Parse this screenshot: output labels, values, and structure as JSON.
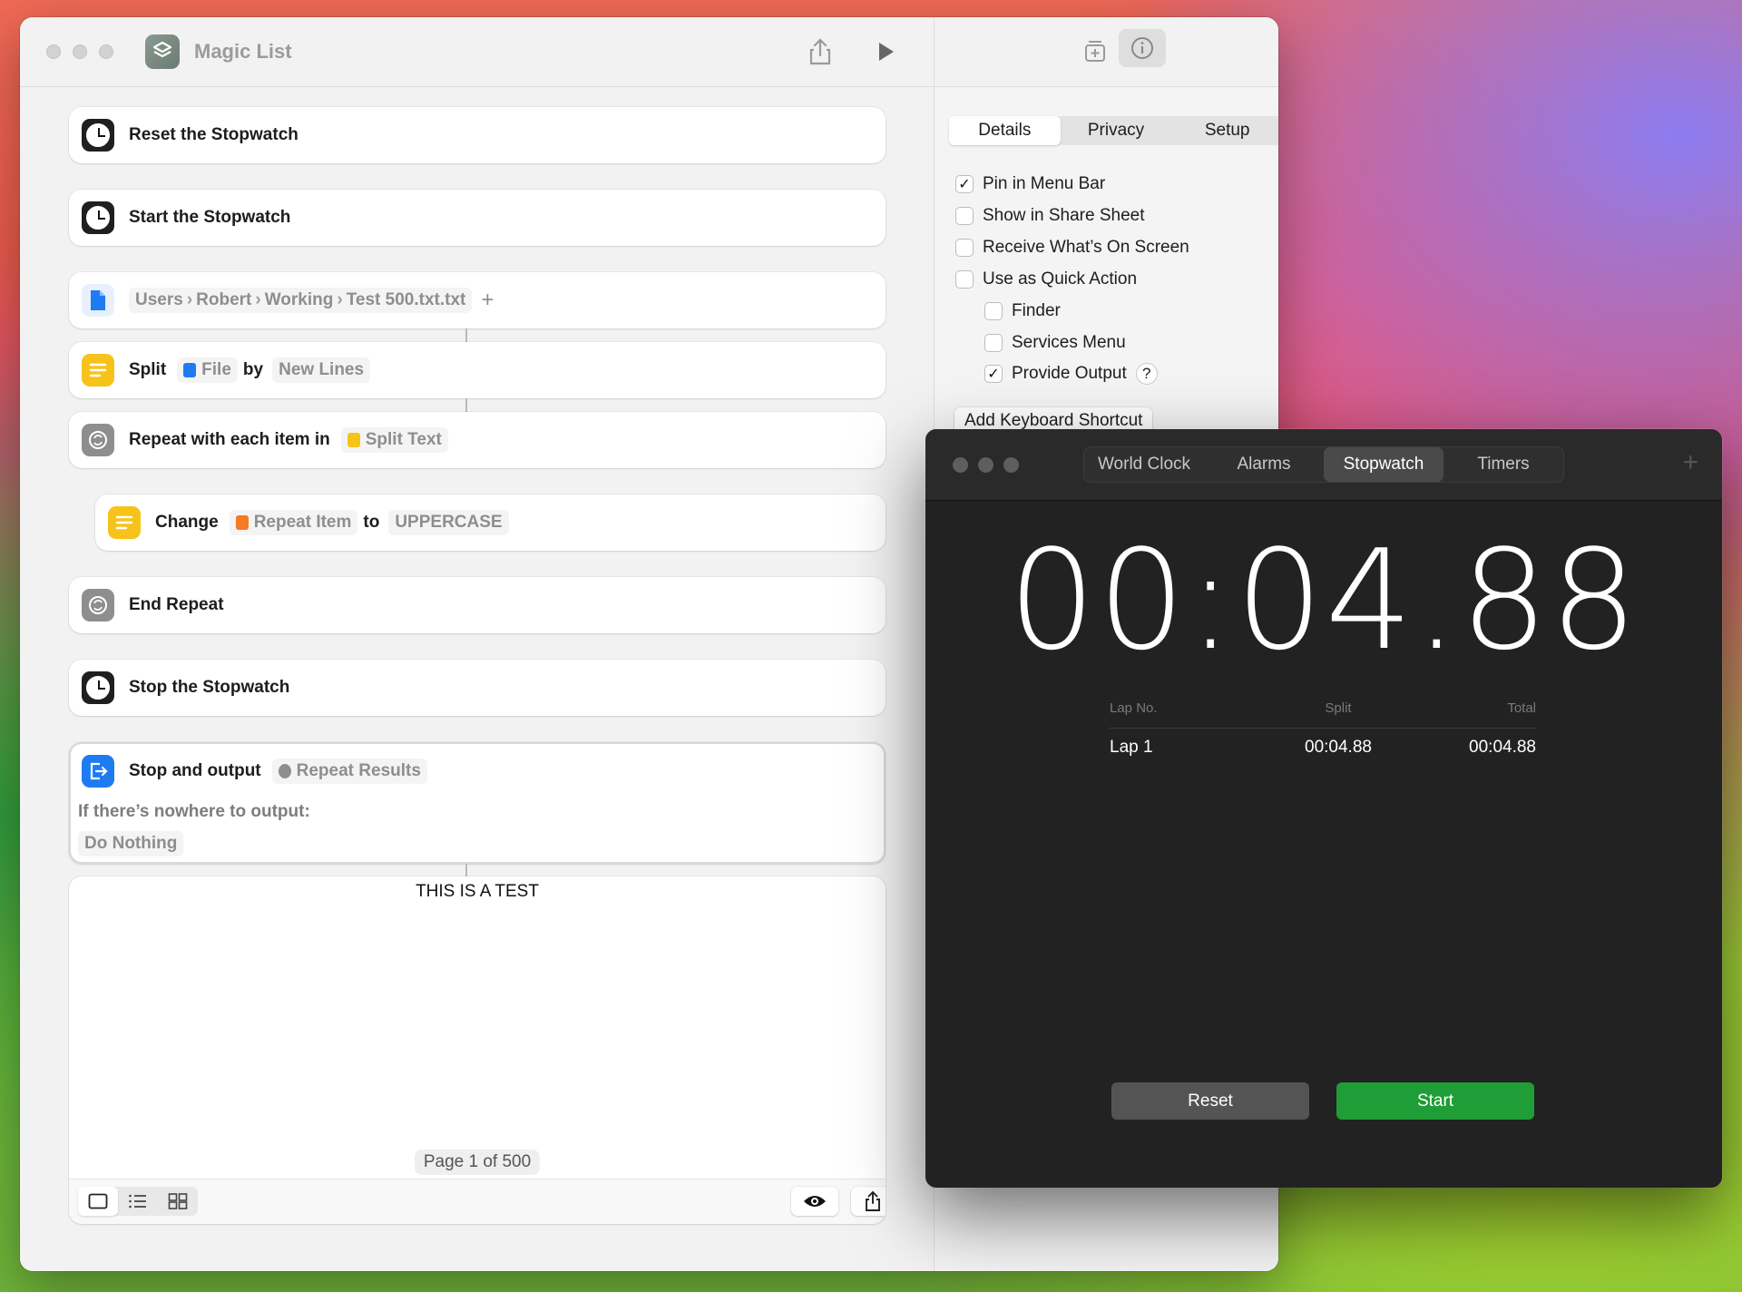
{
  "shortcuts": {
    "title": "Magic List",
    "actions": {
      "reset": "Reset the Stopwatch",
      "start": "Start the Stopwatch",
      "path": [
        "Users",
        "Robert",
        "Working",
        "Test 500.txt.txt"
      ],
      "split_label": "Split",
      "split_file": "File",
      "split_by": "by",
      "split_mode": "New Lines",
      "repeat_label": "Repeat with each item in",
      "repeat_var": "Split Text",
      "change_label": "Change",
      "change_var": "Repeat Item",
      "change_to": "to",
      "change_case": "UPPERCASE",
      "end_repeat": "End Repeat",
      "stop_stopwatch": "Stop the Stopwatch",
      "stop_output_label": "Stop and output",
      "stop_output_var": "Repeat Results",
      "nowhere_label": "If there’s nowhere to output:",
      "nowhere_value": "Do Nothing"
    },
    "output": {
      "text": "THIS IS A TEST",
      "page": "Page 1 of 500"
    },
    "details": {
      "tabs": [
        "Details",
        "Privacy",
        "Setup"
      ],
      "options": [
        {
          "label": "Pin in Menu Bar",
          "checked": true
        },
        {
          "label": "Show in Share Sheet",
          "checked": false
        },
        {
          "label": "Receive What’s On Screen",
          "checked": false
        },
        {
          "label": "Use as Quick Action",
          "checked": false
        },
        {
          "label": "Finder",
          "checked": false
        },
        {
          "label": "Services Menu",
          "checked": false
        },
        {
          "label": "Provide Output",
          "checked": true
        }
      ],
      "help": "?",
      "keyboard_button": "Add Keyboard Shortcut"
    }
  },
  "clock": {
    "tabs": [
      "World Clock",
      "Alarms",
      "Stopwatch",
      "Timers"
    ],
    "time": "00:04.88",
    "lap_headers": [
      "Lap No.",
      "Split",
      "Total"
    ],
    "laps": [
      {
        "no": "Lap 1",
        "split": "00:04.88",
        "total": "00:04.88"
      }
    ],
    "reset_label": "Reset",
    "start_label": "Start",
    "colors": {
      "start": "#1f9d36",
      "reset": "#545454"
    }
  }
}
